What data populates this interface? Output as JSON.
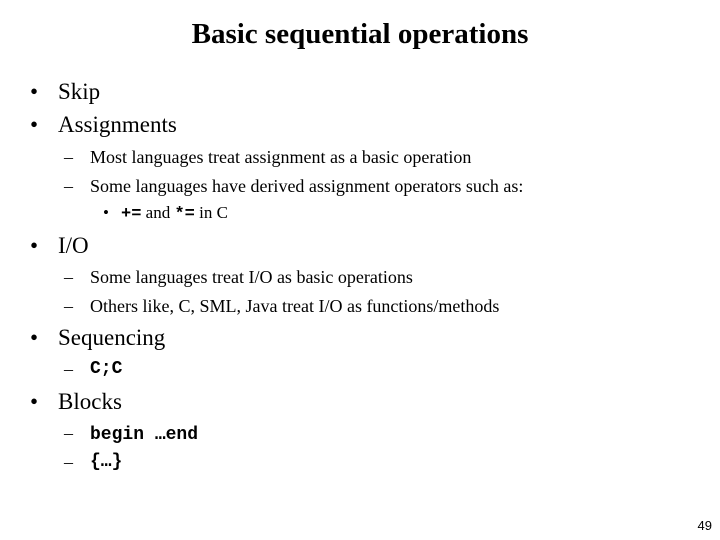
{
  "slide": {
    "title": "Basic sequential operations",
    "page_number": "49",
    "bullet_glyph": "•",
    "dash_glyph": "–",
    "items": {
      "skip": "Skip",
      "assignments": {
        "label": "Assignments",
        "sub1": "Most languages treat assignment as a basic operation",
        "sub2": "Some languages have derived assignment operators such as:",
        "sub2_detail": {
          "op1": "+=",
          "and": " and ",
          "op2": "*=",
          "suffix": " in C"
        }
      },
      "io": {
        "label": "I/O",
        "sub1": "Some languages treat I/O as basic operations",
        "sub2": "Others like, C, SML, Java treat I/O as functions/methods"
      },
      "sequencing": {
        "label": "Sequencing",
        "sub1": "C;C"
      },
      "blocks": {
        "label": "Blocks",
        "sub1_code": "begin",
        "sub1_rest": " …end",
        "sub2": "{…}"
      }
    }
  }
}
